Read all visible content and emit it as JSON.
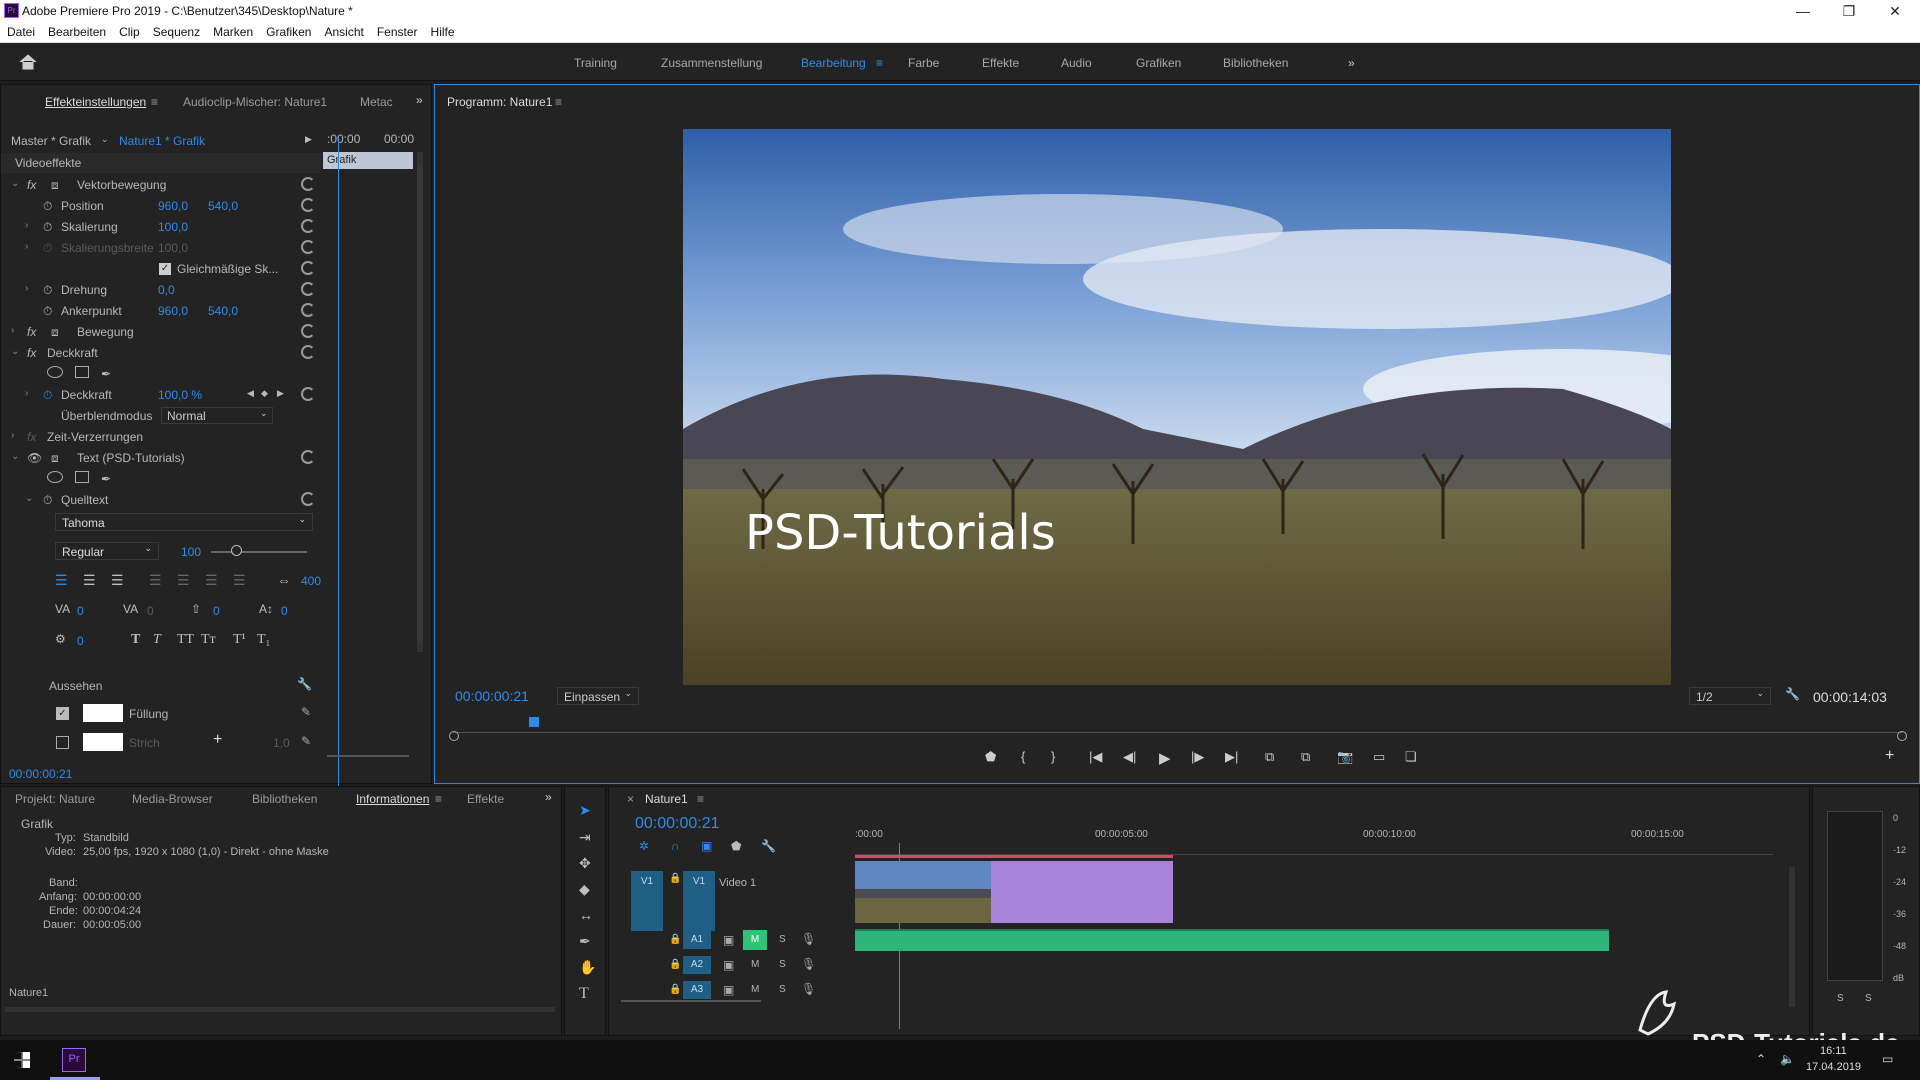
{
  "window": {
    "title": "Adobe Premiere Pro 2019 - C:\\Benutzer\\345\\Desktop\\Nature *",
    "min": "—",
    "max": "❐",
    "close": "✕"
  },
  "menu": [
    "Datei",
    "Bearbeiten",
    "Clip",
    "Sequenz",
    "Marken",
    "Grafiken",
    "Ansicht",
    "Fenster",
    "Hilfe"
  ],
  "workspaces": [
    "Training",
    "Zusammenstellung",
    "Bearbeitung",
    "Farbe",
    "Effekte",
    "Audio",
    "Grafiken",
    "Bibliotheken"
  ],
  "effects": {
    "tabs": [
      "Effekteinstellungen",
      "Audioclip-Mischer: Nature1",
      "Metac"
    ],
    "master": "Master * Grafik",
    "clip": "Nature1 * Grafik",
    "time_a": ":00:00",
    "time_b": "00:00",
    "clip_bar": "Grafik",
    "section": "Videoeffekte",
    "vektor": "Vektorbewegung",
    "position": "Position",
    "pos_x": "960,0",
    "pos_y": "540,0",
    "skalierung": "Skalierung",
    "skal_val": "100,0",
    "skalbreite": "Skalierungsbreite",
    "skalbreite_val": "100,0",
    "gleich": "Gleichmäßige Sk...",
    "drehung": "Drehung",
    "dreh_val": "0,0",
    "anker": "Ankerpunkt",
    "ank_x": "960,0",
    "ank_y": "540,0",
    "bewegung": "Bewegung",
    "deckkraft_grp": "Deckkraft",
    "deckkraft": "Deckkraft",
    "deck_val": "100,0 %",
    "ueberblend": "Überblendmodus",
    "ueberblend_val": "Normal",
    "zeit": "Zeit-Verzerrungen",
    "text": "Text (PSD-Tutorials)",
    "quelltext": "Quelltext",
    "font": "Tahoma",
    "style": "Regular",
    "size": "100",
    "tracking": "400",
    "k0": "0",
    "k1": "0",
    "k2": "0",
    "k3": "0",
    "k4": "0",
    "aussehen": "Aussehen",
    "fuellung": "Füllung",
    "strich": "Strich",
    "strich_val": "1,0",
    "timecode": "00:00:00:21"
  },
  "program": {
    "title": "Programm: Nature1",
    "timecode": "00:00:00:21",
    "fit": "Einpassen",
    "quality": "1/2",
    "duration": "00:00:14:03",
    "overlay_text": "PSD-Tutorials"
  },
  "project": {
    "tabs": [
      "Projekt: Nature",
      "Media-Browser",
      "Bibliotheken",
      "Informationen",
      "Effekte"
    ],
    "heading": "Grafik",
    "typ_label": "Typ:",
    "typ": "Standbild",
    "video_label": "Video:",
    "video": "25,00 fps, 1920 x 1080 (1,0) - Direkt - ohne Maske",
    "band_label": "Band:",
    "anfang_label": "Anfang:",
    "anfang": "00:00:00:00",
    "ende_label": "Ende:",
    "ende": "00:00:04:24",
    "dauer_label": "Dauer:",
    "dauer": "00:00:05:00",
    "footer": "Nature1"
  },
  "timeline": {
    "seq": "Nature1",
    "timecode": "00:00:00:21",
    "ruler": [
      ":00:00",
      "00:00:05:00",
      "00:00:10:00",
      "00:00:15:00"
    ],
    "v1": "V1",
    "v1_name": "Video 1",
    "a1": "A1",
    "a2": "A2",
    "a3": "A3",
    "m": "M",
    "s": "S"
  },
  "meter": {
    "scale": [
      "0",
      "-12",
      "-24",
      "-36",
      "-48",
      "dB"
    ],
    "s1": "S",
    "s2": "S"
  },
  "watermark": "PSD-Tutorials.de",
  "taskbar": {
    "time": "16:11",
    "date": "17.04.2019",
    "app": "Pr"
  },
  "colors": {
    "accent": "#2d8ceb",
    "clip_purple": "#a784d9",
    "audio_green": "#2fb47a",
    "bg": "#232323"
  }
}
